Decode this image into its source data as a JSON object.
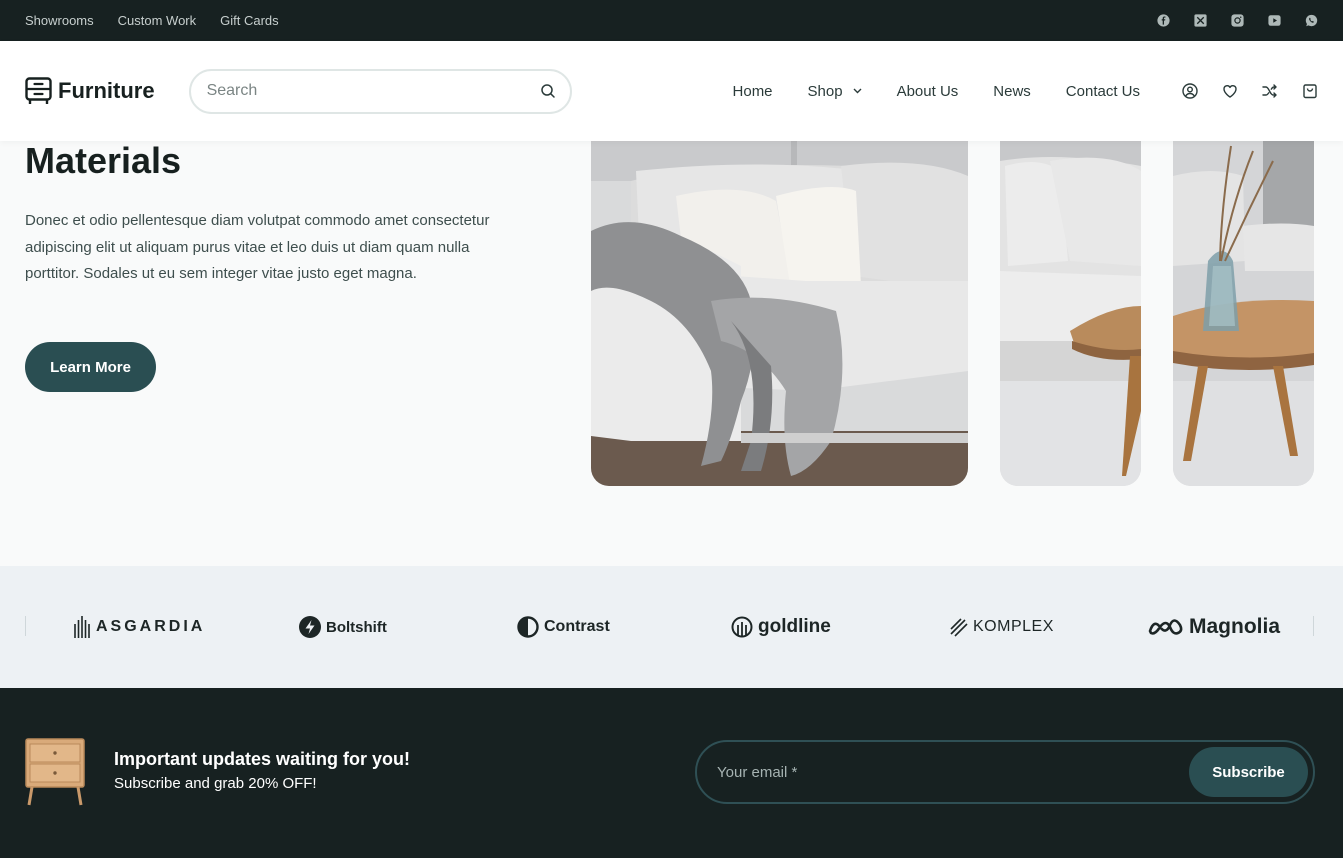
{
  "topbar": {
    "links": [
      "Showrooms",
      "Custom Work",
      "Gift Cards"
    ],
    "social_icons": [
      "facebook-icon",
      "x-twitter-icon",
      "instagram-icon",
      "youtube-icon",
      "whatsapp-icon"
    ]
  },
  "header": {
    "logo_text": "Furniture",
    "search_placeholder": "Search",
    "nav": [
      {
        "label": "Home"
      },
      {
        "label": "Shop",
        "has_dropdown": true
      },
      {
        "label": "About Us"
      },
      {
        "label": "News"
      },
      {
        "label": "Contact Us"
      }
    ],
    "icons": [
      "account-icon",
      "wishlist-heart-icon",
      "compare-shuffle-icon",
      "cart-bag-icon"
    ]
  },
  "hero": {
    "title": "Materials",
    "description": "Donec et odio pellentesque diam volutpat commodo amet consectetur adipiscing elit ut aliquam purus vitae et leo duis ut diam quam nulla porttitor. Sodales ut eu sem integer vitae justo eget magna.",
    "button_label": "Learn More"
  },
  "brands": [
    "ASGARDIA",
    "Boltshift",
    "Contrast",
    "goldline",
    "KOMPLEX",
    "Magnolia"
  ],
  "newsletter": {
    "title": "Important updates waiting for you!",
    "subtitle": "Subscribe and grab 20% OFF!",
    "email_placeholder": "Your email *",
    "button_label": "Subscribe"
  },
  "colors": {
    "dark": "#172121",
    "accent": "#2a4e52",
    "brand_strip": "#edf1f4"
  }
}
